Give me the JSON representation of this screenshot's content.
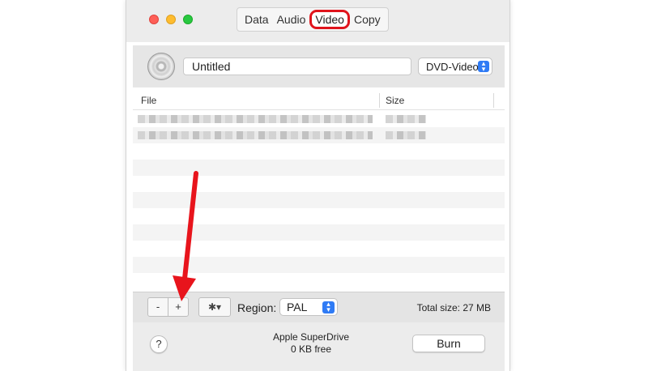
{
  "tabs": [
    {
      "label": "Data"
    },
    {
      "label": "Audio"
    },
    {
      "label": "Video"
    },
    {
      "label": "Copy"
    }
  ],
  "active_tab": "Video",
  "disc": {
    "title": "Untitled",
    "format": "DVD-Video"
  },
  "list": {
    "columns": {
      "file": "File",
      "size": "Size"
    }
  },
  "toolbar": {
    "minus_label": "-",
    "plus_label": "+",
    "gear_label": "✱▾",
    "region_label": "Region:",
    "region_value": "PAL",
    "total_size": "Total size: 27 MB"
  },
  "footer": {
    "help_label": "?",
    "drive_name": "Apple SuperDrive",
    "drive_free": "0 KB free",
    "burn_label": "Burn"
  },
  "colors": {
    "highlight": "#e0141c",
    "accent": "#2f7bf5"
  }
}
